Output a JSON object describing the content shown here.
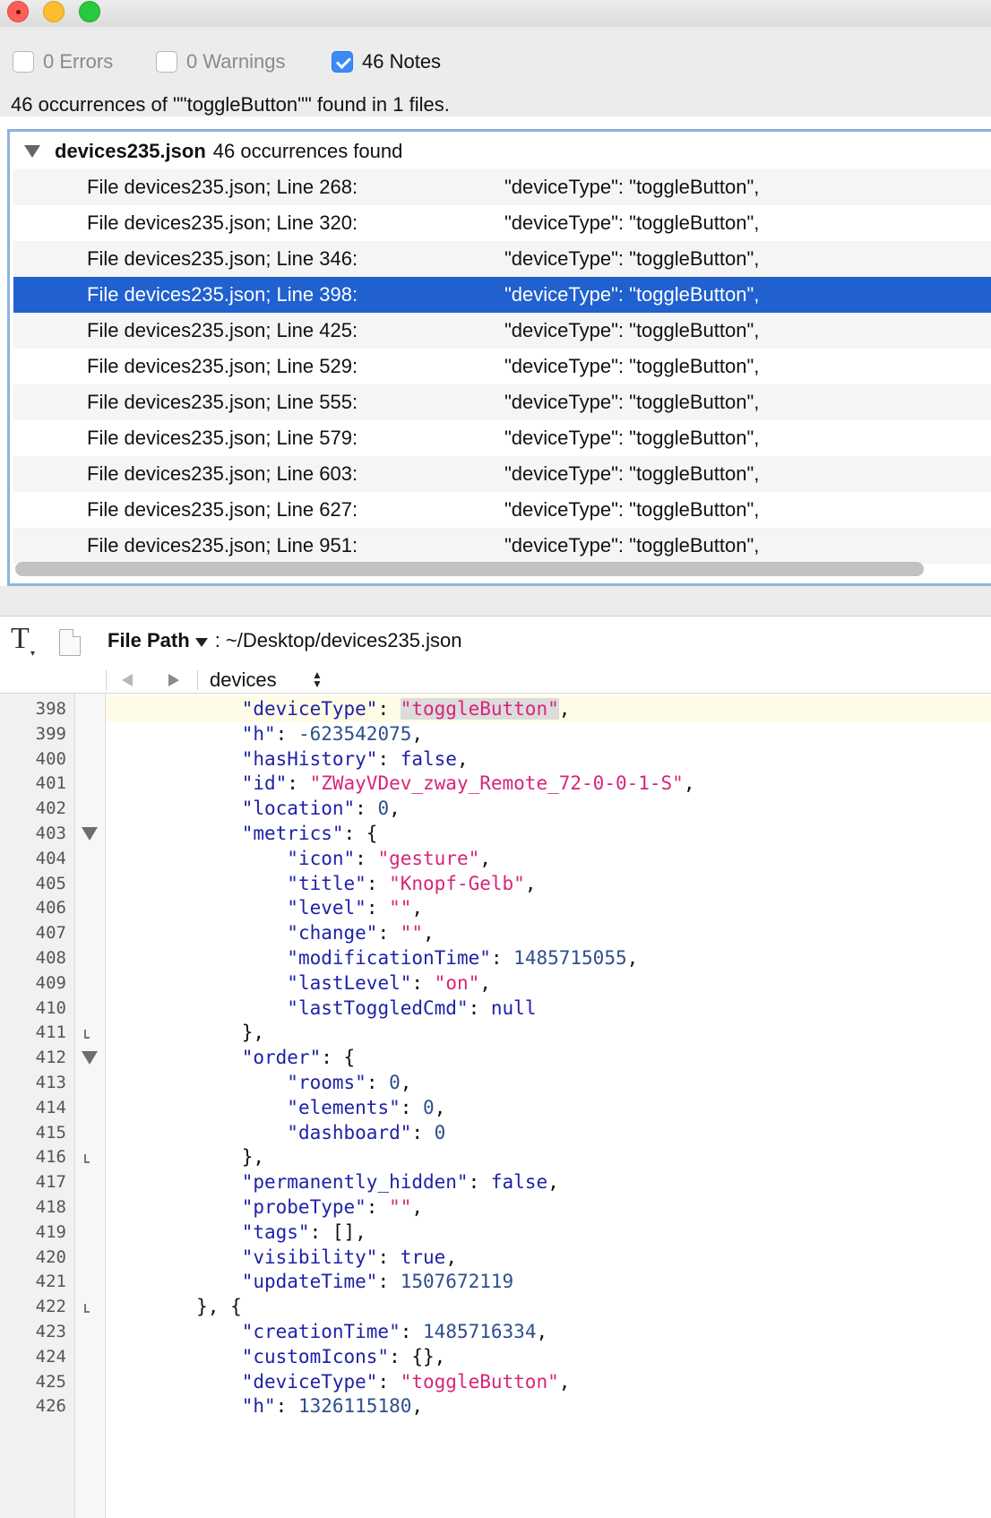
{
  "filters": {
    "errors": {
      "label": "0 Errors",
      "checked": false
    },
    "warnings": {
      "label": "0 Warnings",
      "checked": false
    },
    "notes": {
      "label": "46 Notes",
      "checked": true
    }
  },
  "summary": "46 occurrences of \"\"toggleButton\"\" found in 1 files.",
  "results": {
    "group": {
      "file": "devices235.json",
      "count_text": "46 occurrences found"
    },
    "rows": [
      {
        "location": "File devices235.json; Line 268:",
        "snippet": "\"deviceType\": \"toggleButton\","
      },
      {
        "location": "File devices235.json; Line 320:",
        "snippet": "\"deviceType\": \"toggleButton\","
      },
      {
        "location": "File devices235.json; Line 346:",
        "snippet": "\"deviceType\": \"toggleButton\","
      },
      {
        "location": "File devices235.json; Line 398:",
        "snippet": "\"deviceType\": \"toggleButton\",",
        "selected": true
      },
      {
        "location": "File devices235.json; Line 425:",
        "snippet": "\"deviceType\": \"toggleButton\","
      },
      {
        "location": "File devices235.json; Line 529:",
        "snippet": "\"deviceType\": \"toggleButton\","
      },
      {
        "location": "File devices235.json; Line 555:",
        "snippet": "\"deviceType\": \"toggleButton\","
      },
      {
        "location": "File devices235.json; Line 579:",
        "snippet": "\"deviceType\": \"toggleButton\","
      },
      {
        "location": "File devices235.json; Line 603:",
        "snippet": "\"deviceType\": \"toggleButton\","
      },
      {
        "location": "File devices235.json; Line 627:",
        "snippet": "\"deviceType\": \"toggleButton\","
      },
      {
        "location": "File devices235.json; Line 951:",
        "snippet": "\"deviceType\": \"toggleButton\","
      }
    ]
  },
  "editor": {
    "text_icon": "T",
    "file_path_label": "File Path",
    "file_path_value": ": ~/Desktop/devices235.json",
    "symbol": "devices",
    "lines": [
      {
        "n": "398",
        "fold": "",
        "tokens": [
          [
            "p",
            "            "
          ],
          [
            "k",
            "\"deviceType\""
          ],
          [
            "p",
            ": "
          ],
          [
            "s hl",
            "\"toggleButton\""
          ],
          [
            "p",
            ","
          ]
        ]
      },
      {
        "n": "399",
        "fold": "",
        "tokens": [
          [
            "p",
            "            "
          ],
          [
            "k",
            "\"h\""
          ],
          [
            "p",
            ": "
          ],
          [
            "n",
            "-623542075"
          ],
          [
            "p",
            ","
          ]
        ]
      },
      {
        "n": "400",
        "fold": "",
        "tokens": [
          [
            "p",
            "            "
          ],
          [
            "k",
            "\"hasHistory\""
          ],
          [
            "p",
            ": "
          ],
          [
            "kw",
            "false"
          ],
          [
            "p",
            ","
          ]
        ]
      },
      {
        "n": "401",
        "fold": "",
        "tokens": [
          [
            "p",
            "            "
          ],
          [
            "k",
            "\"id\""
          ],
          [
            "p",
            ": "
          ],
          [
            "s",
            "\"ZWayVDev_zway_Remote_72-0-0-1-S\""
          ],
          [
            "p",
            ","
          ]
        ]
      },
      {
        "n": "402",
        "fold": "",
        "tokens": [
          [
            "p",
            "            "
          ],
          [
            "k",
            "\"location\""
          ],
          [
            "p",
            ": "
          ],
          [
            "n",
            "0"
          ],
          [
            "p",
            ","
          ]
        ]
      },
      {
        "n": "403",
        "fold": "open",
        "tokens": [
          [
            "p",
            "            "
          ],
          [
            "k",
            "\"metrics\""
          ],
          [
            "p",
            ": {"
          ]
        ]
      },
      {
        "n": "404",
        "fold": "",
        "tokens": [
          [
            "p",
            "                "
          ],
          [
            "k",
            "\"icon\""
          ],
          [
            "p",
            ": "
          ],
          [
            "s",
            "\"gesture\""
          ],
          [
            "p",
            ","
          ]
        ]
      },
      {
        "n": "405",
        "fold": "",
        "tokens": [
          [
            "p",
            "                "
          ],
          [
            "k",
            "\"title\""
          ],
          [
            "p",
            ": "
          ],
          [
            "s",
            "\"Knopf-Gelb\""
          ],
          [
            "p",
            ","
          ]
        ]
      },
      {
        "n": "406",
        "fold": "",
        "tokens": [
          [
            "p",
            "                "
          ],
          [
            "k",
            "\"level\""
          ],
          [
            "p",
            ": "
          ],
          [
            "s",
            "\"\""
          ],
          [
            "p",
            ","
          ]
        ]
      },
      {
        "n": "407",
        "fold": "",
        "tokens": [
          [
            "p",
            "                "
          ],
          [
            "k",
            "\"change\""
          ],
          [
            "p",
            ": "
          ],
          [
            "s",
            "\"\""
          ],
          [
            "p",
            ","
          ]
        ]
      },
      {
        "n": "408",
        "fold": "",
        "tokens": [
          [
            "p",
            "                "
          ],
          [
            "k",
            "\"modificationTime\""
          ],
          [
            "p",
            ": "
          ],
          [
            "n",
            "1485715055"
          ],
          [
            "p",
            ","
          ]
        ]
      },
      {
        "n": "409",
        "fold": "",
        "tokens": [
          [
            "p",
            "                "
          ],
          [
            "k",
            "\"lastLevel\""
          ],
          [
            "p",
            ": "
          ],
          [
            "s",
            "\"on\""
          ],
          [
            "p",
            ","
          ]
        ]
      },
      {
        "n": "410",
        "fold": "",
        "tokens": [
          [
            "p",
            "                "
          ],
          [
            "k",
            "\"lastToggledCmd\""
          ],
          [
            "p",
            ": "
          ],
          [
            "kw",
            "null"
          ]
        ]
      },
      {
        "n": "411",
        "fold": "end",
        "tokens": [
          [
            "p",
            "            },"
          ]
        ]
      },
      {
        "n": "412",
        "fold": "open",
        "tokens": [
          [
            "p",
            "            "
          ],
          [
            "k",
            "\"order\""
          ],
          [
            "p",
            ": {"
          ]
        ]
      },
      {
        "n": "413",
        "fold": "",
        "tokens": [
          [
            "p",
            "                "
          ],
          [
            "k",
            "\"rooms\""
          ],
          [
            "p",
            ": "
          ],
          [
            "n",
            "0"
          ],
          [
            "p",
            ","
          ]
        ]
      },
      {
        "n": "414",
        "fold": "",
        "tokens": [
          [
            "p",
            "                "
          ],
          [
            "k",
            "\"elements\""
          ],
          [
            "p",
            ": "
          ],
          [
            "n",
            "0"
          ],
          [
            "p",
            ","
          ]
        ]
      },
      {
        "n": "415",
        "fold": "",
        "tokens": [
          [
            "p",
            "                "
          ],
          [
            "k",
            "\"dashboard\""
          ],
          [
            "p",
            ": "
          ],
          [
            "n",
            "0"
          ]
        ]
      },
      {
        "n": "416",
        "fold": "end",
        "tokens": [
          [
            "p",
            "            },"
          ]
        ]
      },
      {
        "n": "417",
        "fold": "",
        "tokens": [
          [
            "p",
            "            "
          ],
          [
            "k",
            "\"permanently_hidden\""
          ],
          [
            "p",
            ": "
          ],
          [
            "kw",
            "false"
          ],
          [
            "p",
            ","
          ]
        ]
      },
      {
        "n": "418",
        "fold": "",
        "tokens": [
          [
            "p",
            "            "
          ],
          [
            "k",
            "\"probeType\""
          ],
          [
            "p",
            ": "
          ],
          [
            "s",
            "\"\""
          ],
          [
            "p",
            ","
          ]
        ]
      },
      {
        "n": "419",
        "fold": "",
        "tokens": [
          [
            "p",
            "            "
          ],
          [
            "k",
            "\"tags\""
          ],
          [
            "p",
            ": [],"
          ]
        ]
      },
      {
        "n": "420",
        "fold": "",
        "tokens": [
          [
            "p",
            "            "
          ],
          [
            "k",
            "\"visibility\""
          ],
          [
            "p",
            ": "
          ],
          [
            "kw",
            "true"
          ],
          [
            "p",
            ","
          ]
        ]
      },
      {
        "n": "421",
        "fold": "",
        "tokens": [
          [
            "p",
            "            "
          ],
          [
            "k",
            "\"updateTime\""
          ],
          [
            "p",
            ": "
          ],
          [
            "n",
            "1507672119"
          ]
        ]
      },
      {
        "n": "422",
        "fold": "end",
        "tokens": [
          [
            "p",
            "        }, {"
          ]
        ]
      },
      {
        "n": "423",
        "fold": "",
        "tokens": [
          [
            "p",
            "            "
          ],
          [
            "k",
            "\"creationTime\""
          ],
          [
            "p",
            ": "
          ],
          [
            "n",
            "1485716334"
          ],
          [
            "p",
            ","
          ]
        ]
      },
      {
        "n": "424",
        "fold": "",
        "tokens": [
          [
            "p",
            "            "
          ],
          [
            "k",
            "\"customIcons\""
          ],
          [
            "p",
            ": {},"
          ]
        ]
      },
      {
        "n": "425",
        "fold": "",
        "tokens": [
          [
            "p",
            "            "
          ],
          [
            "k",
            "\"deviceType\""
          ],
          [
            "p",
            ": "
          ],
          [
            "s",
            "\"toggleButton\""
          ],
          [
            "p",
            ","
          ]
        ]
      },
      {
        "n": "426",
        "fold": "",
        "tokens": [
          [
            "p",
            "            "
          ],
          [
            "k",
            "\"h\""
          ],
          [
            "p",
            ": "
          ],
          [
            "n",
            "1326115180"
          ],
          [
            "p",
            ","
          ]
        ]
      }
    ]
  }
}
